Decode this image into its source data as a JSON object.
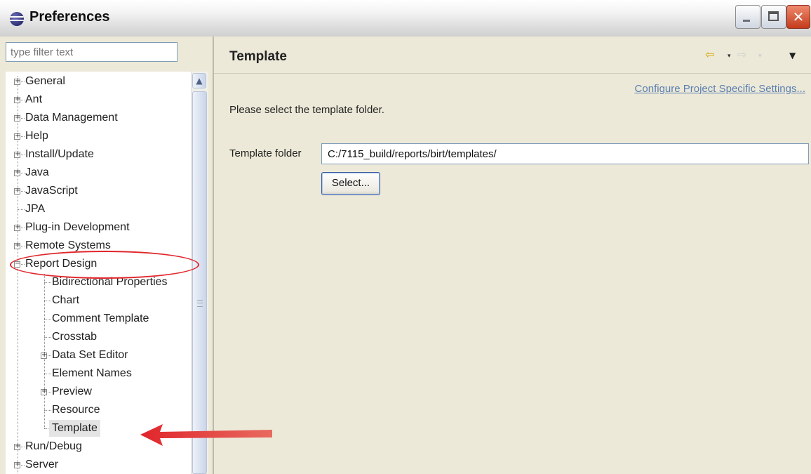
{
  "window": {
    "title": "Preferences",
    "icon": "eclipse-icon",
    "controls": {
      "minimize": "minimize",
      "maximize": "maximize",
      "close": "✕"
    }
  },
  "sidebar": {
    "filter_placeholder": "type filter text",
    "tree": [
      {
        "label": "General",
        "level": 0,
        "expandable": true,
        "expanded": false
      },
      {
        "label": "Ant",
        "level": 0,
        "expandable": true,
        "expanded": false
      },
      {
        "label": "Data Management",
        "level": 0,
        "expandable": true,
        "expanded": false
      },
      {
        "label": "Help",
        "level": 0,
        "expandable": true,
        "expanded": false
      },
      {
        "label": "Install/Update",
        "level": 0,
        "expandable": true,
        "expanded": false
      },
      {
        "label": "Java",
        "level": 0,
        "expandable": true,
        "expanded": false
      },
      {
        "label": "JavaScript",
        "level": 0,
        "expandable": true,
        "expanded": false
      },
      {
        "label": "JPA",
        "level": 0,
        "expandable": false,
        "expanded": false
      },
      {
        "label": "Plug-in Development",
        "level": 0,
        "expandable": true,
        "expanded": false
      },
      {
        "label": "Remote Systems",
        "level": 0,
        "expandable": true,
        "expanded": false
      },
      {
        "label": "Report Design",
        "level": 0,
        "expandable": true,
        "expanded": true
      },
      {
        "label": "Bidirectional Properties",
        "level": 1,
        "expandable": false,
        "expanded": false
      },
      {
        "label": "Chart",
        "level": 1,
        "expandable": false,
        "expanded": false
      },
      {
        "label": "Comment Template",
        "level": 1,
        "expandable": false,
        "expanded": false
      },
      {
        "label": "Crosstab",
        "level": 1,
        "expandable": false,
        "expanded": false
      },
      {
        "label": "Data Set Editor",
        "level": 1,
        "expandable": true,
        "expanded": false
      },
      {
        "label": "Element Names",
        "level": 1,
        "expandable": false,
        "expanded": false
      },
      {
        "label": "Preview",
        "level": 1,
        "expandable": true,
        "expanded": false
      },
      {
        "label": "Resource",
        "level": 1,
        "expandable": false,
        "expanded": false
      },
      {
        "label": "Template",
        "level": 1,
        "expandable": false,
        "expanded": false,
        "selected": true
      },
      {
        "label": "Run/Debug",
        "level": 0,
        "expandable": true,
        "expanded": false
      },
      {
        "label": "Server",
        "level": 0,
        "expandable": true,
        "expanded": false
      }
    ]
  },
  "page": {
    "title": "Template",
    "config_link": "Configure Project Specific Settings...",
    "description": "Please select the template folder.",
    "field_label": "Template folder",
    "field_value": "C:/7115_build/reports/birt/templates/",
    "select_button": "Select..."
  },
  "nav": {
    "back": "⇦",
    "forward": "⇨",
    "dropdown": "▾",
    "menu": "▼"
  },
  "colors": {
    "annotation": "#e0252b",
    "link": "#5b7fb0",
    "background": "#ece9d8"
  }
}
